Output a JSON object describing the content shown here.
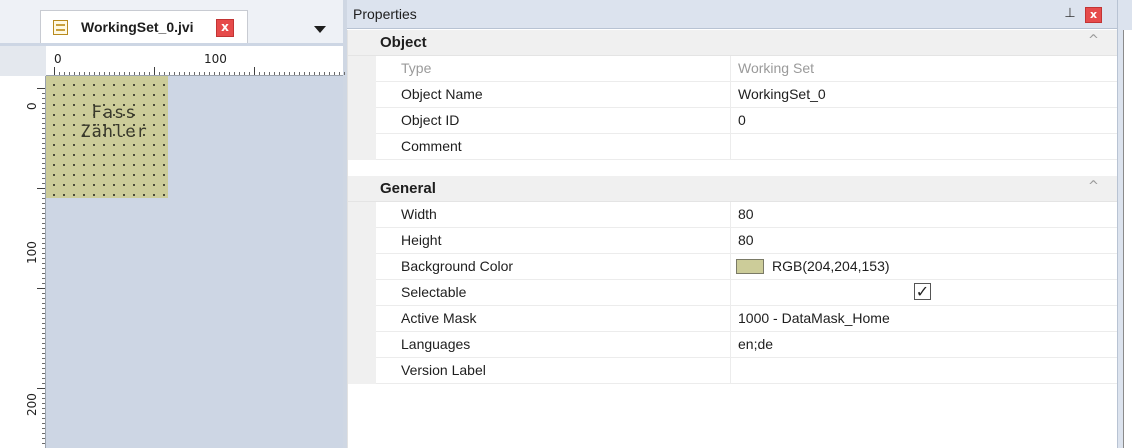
{
  "document_tab": {
    "title": "WorkingSet_0.jvi",
    "close_label": "x"
  },
  "ruler": {
    "h_labels": [
      "0",
      "100"
    ],
    "v_labels": [
      "0",
      "100",
      "200"
    ]
  },
  "canvas": {
    "working_set_text_line1": "Fass",
    "working_set_text_line2": "Zähler",
    "background_color": "#cccc99"
  },
  "properties": {
    "title": "Properties",
    "pin_icon": "⊥",
    "close_label": "x",
    "categories": [
      {
        "label": "Object",
        "collapse_icon": "^",
        "rows": [
          {
            "name": "Type",
            "value": "Working Set"
          },
          {
            "name": "Object Name",
            "value": "WorkingSet_0"
          },
          {
            "name": "Object ID",
            "value": "0"
          },
          {
            "name": "Comment",
            "value": ""
          }
        ]
      },
      {
        "label": "General",
        "collapse_icon": "^",
        "rows": [
          {
            "name": "Width",
            "value": "80"
          },
          {
            "name": "Height",
            "value": "80"
          },
          {
            "name": "Background Color",
            "value": "RGB(204,204,153)"
          },
          {
            "name": "Selectable",
            "value": "✓"
          },
          {
            "name": "Active Mask",
            "value": "1000 - DataMask_Home"
          },
          {
            "name": "Languages",
            "value": "en;de"
          },
          {
            "name": "Version Label",
            "value": ""
          }
        ]
      }
    ]
  }
}
